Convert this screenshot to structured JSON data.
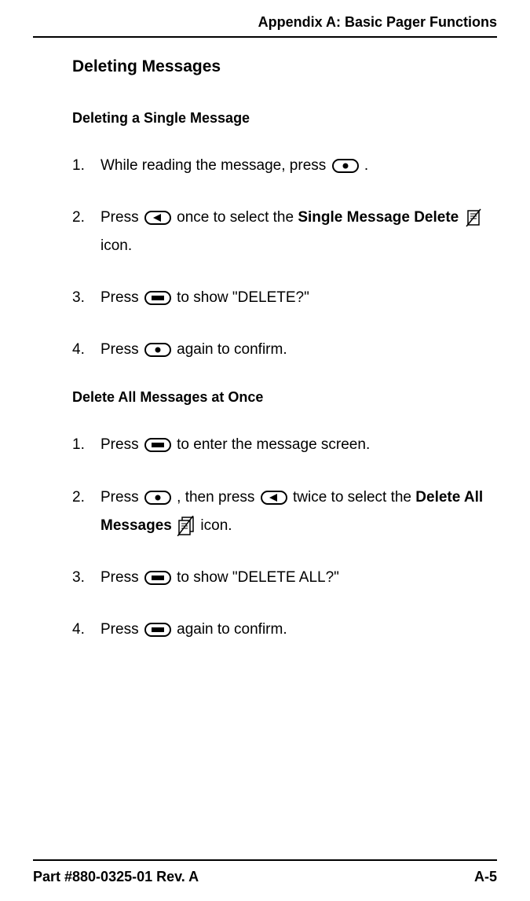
{
  "header": {
    "title": "Appendix A: Basic Pager Functions"
  },
  "section": {
    "title": "Deleting Messages",
    "sub1": {
      "title": "Deleting a Single Message",
      "steps": {
        "s1a": "While reading the message, press ",
        "s1b": " .",
        "s2a": "Press ",
        "s2b": " once to select the ",
        "s2bold": "Single Message Delete",
        "s2c": " icon.",
        "s3a": "Press ",
        "s3b": " to show \"DELETE?\"",
        "s4a": "Press ",
        "s4b": " again to confirm."
      }
    },
    "sub2": {
      "title": "Delete All Messages at Once",
      "steps": {
        "s1a": "Press ",
        "s1b": " to enter the message screen.",
        "s2a": "Press ",
        "s2b": " , then press ",
        "s2c": " twice to select the ",
        "s2bold": "Delete All Messages",
        "s2d": " icon.",
        "s3a": "Press ",
        "s3b": " to show \"DELETE ALL?\"",
        "s4a": "Press ",
        "s4b": " again to confirm."
      }
    }
  },
  "footer": {
    "left": "Part #880-0325-01 Rev. A",
    "right": "A-5"
  }
}
